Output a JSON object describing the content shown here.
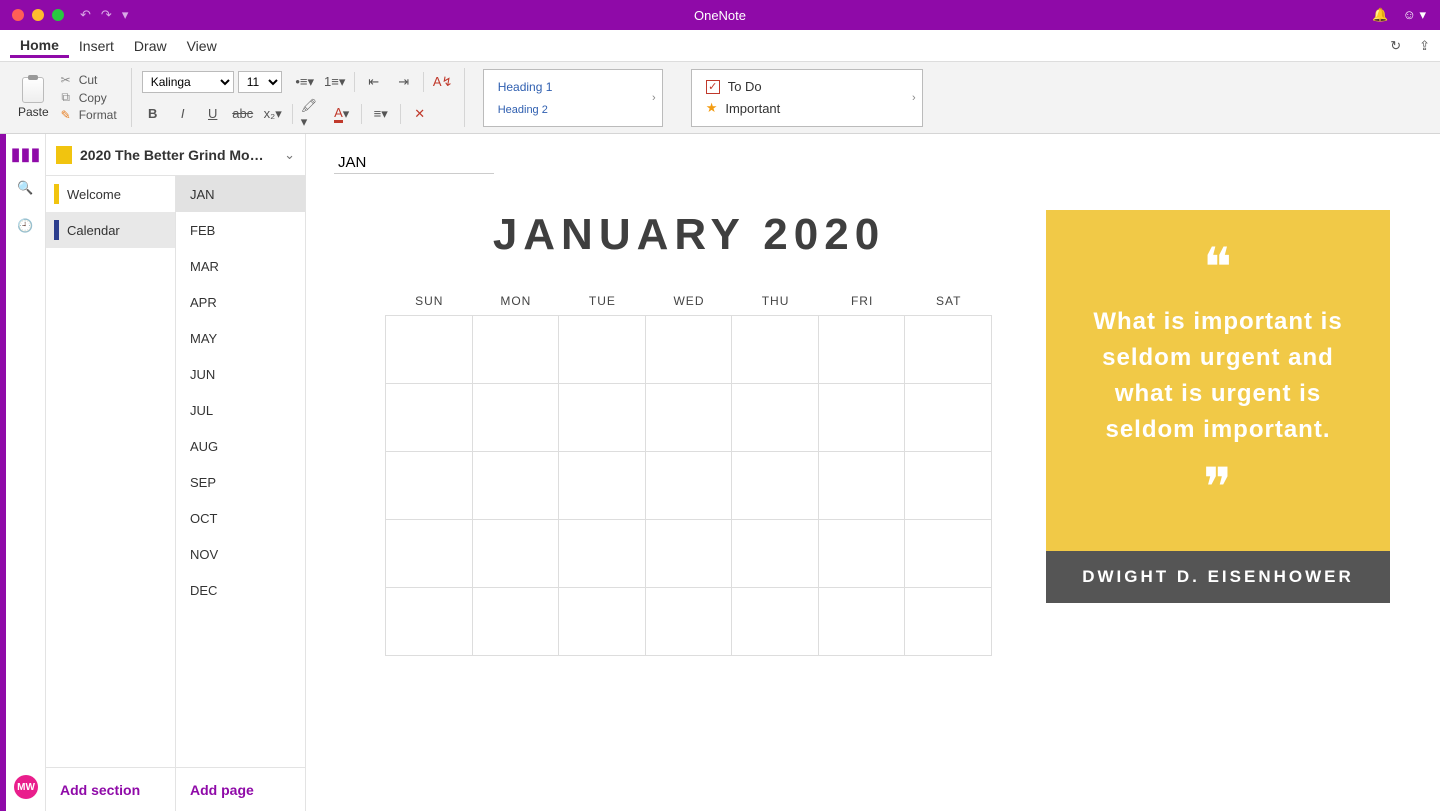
{
  "app": {
    "title": "OneNote"
  },
  "menu": {
    "items": [
      "Home",
      "Insert",
      "Draw",
      "View"
    ],
    "active": "Home"
  },
  "ribbon": {
    "paste_label": "Paste",
    "clipboard": {
      "cut": "Cut",
      "copy": "Copy",
      "format": "Format"
    },
    "font_name": "Kalinga",
    "font_size": "11",
    "styles": {
      "h1": "Heading 1",
      "h2": "Heading 2"
    },
    "tags": {
      "todo": "To Do",
      "important": "Important"
    }
  },
  "notebook": {
    "title": "2020 The Better Grind Mo…",
    "sections": [
      {
        "id": "welcome",
        "label": "Welcome"
      },
      {
        "id": "calendar",
        "label": "Calendar"
      }
    ],
    "active_section": "calendar",
    "pages": [
      "JAN",
      "FEB",
      "MAR",
      "APR",
      "MAY",
      "JUN",
      "JUL",
      "AUG",
      "SEP",
      "OCT",
      "NOV",
      "DEC"
    ],
    "active_page": "JAN",
    "add_section": "Add section",
    "add_page": "Add page"
  },
  "page": {
    "title": "JAN",
    "calendar_heading": "JANUARY 2020",
    "dow": [
      "SUN",
      "MON",
      "TUE",
      "WED",
      "THU",
      "FRI",
      "SAT"
    ],
    "quote": {
      "text": "What is important is seldom urgent and what is urgent is seldom important.",
      "author": "DWIGHT D. EISENHOWER"
    }
  },
  "user": {
    "initials": "MW"
  }
}
